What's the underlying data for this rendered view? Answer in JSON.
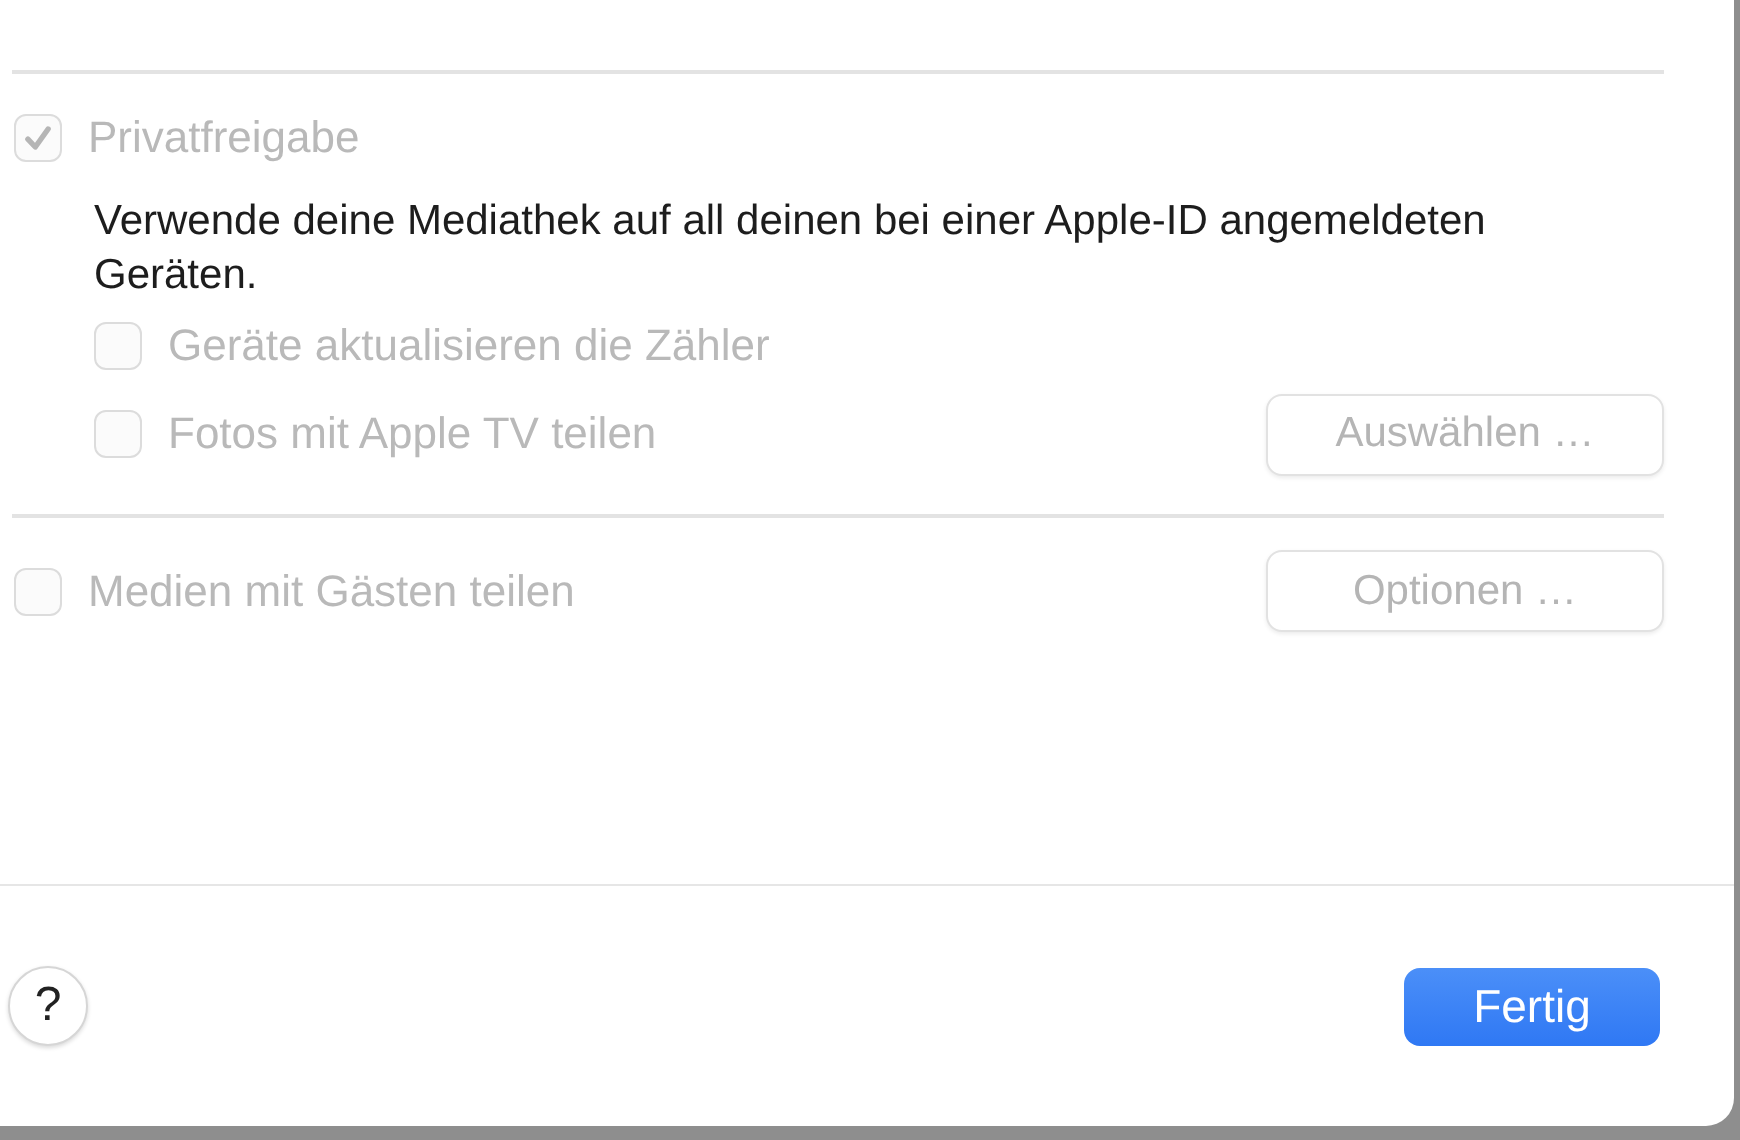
{
  "home_sharing": {
    "label": "Privatfreigabe",
    "checked": true,
    "disabled": true,
    "description": "Verwende deine Mediathek auf all deinen bei einer Apple-ID angemeldeten Geräten.",
    "options": [
      {
        "label": "Geräte aktualisieren die Zähler",
        "checked": false,
        "disabled": true
      },
      {
        "label": "Fotos mit Apple TV teilen",
        "checked": false,
        "disabled": true,
        "button": {
          "label": "Auswählen …",
          "disabled": true
        }
      }
    ]
  },
  "guest_sharing": {
    "label": "Medien mit Gästen teilen",
    "checked": false,
    "disabled": true,
    "button": {
      "label": "Optionen …",
      "disabled": true
    }
  },
  "footer": {
    "help": "?",
    "done": "Fertig"
  }
}
